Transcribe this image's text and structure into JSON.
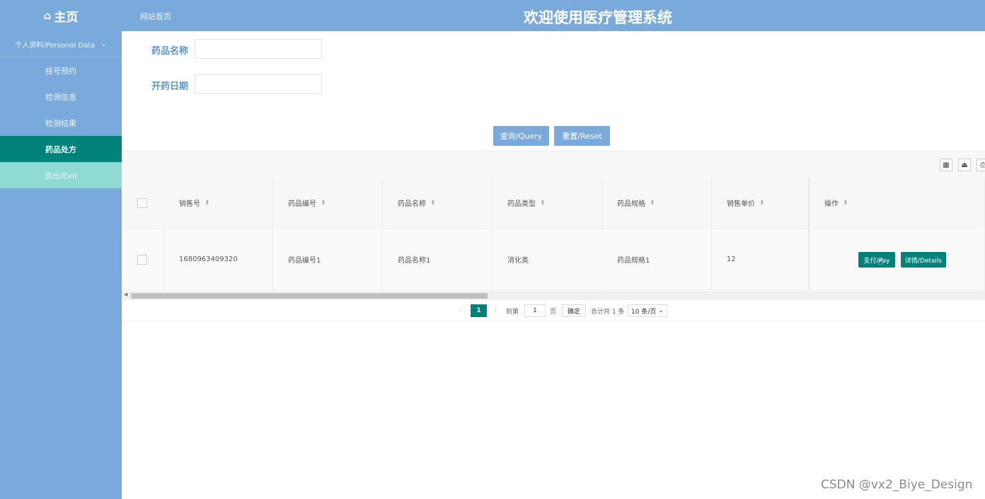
{
  "header": {
    "logo_icon": "home-icon",
    "logo_label": "主页",
    "breadcrumb": "网站首页",
    "system_title": "欢迎使用医疗管理系统",
    "bg_color": "#7aaadb"
  },
  "sidebar": {
    "section_label": "个人资料/Personal Data",
    "items": [
      {
        "label": "挂号预约"
      },
      {
        "label": "检测信息"
      },
      {
        "label": "检测结果"
      },
      {
        "label": "药品处方"
      },
      {
        "label": "退出/Exit"
      }
    ],
    "active_color": "#00817a"
  },
  "search": {
    "name_label": "药品名称",
    "name_value": "",
    "date_label": "开药日期",
    "date_value": "",
    "query_button": "查询/Query",
    "reset_button": "重置/Reset"
  },
  "table": {
    "columns": [
      "销售号",
      "药品编号",
      "药品名称",
      "药品类型",
      "药品规格",
      "销售单价",
      "操作"
    ],
    "rows": [
      {
        "cells": [
          "1680963409320",
          "药品编号1",
          "药品名称1",
          "消化类",
          "药品规格1",
          "12"
        ],
        "pay_button": "支付/Pay",
        "details_button": "详情/Details"
      }
    ]
  },
  "pagination": {
    "current_page": "1",
    "goto_label": "到第",
    "goto_value": "1",
    "page_unit": "页",
    "confirm_button": "确定",
    "total_text": "合计共 1 条",
    "page_size": "10 条/页"
  },
  "watermark": "CSDN @vx2_Biye_Design"
}
